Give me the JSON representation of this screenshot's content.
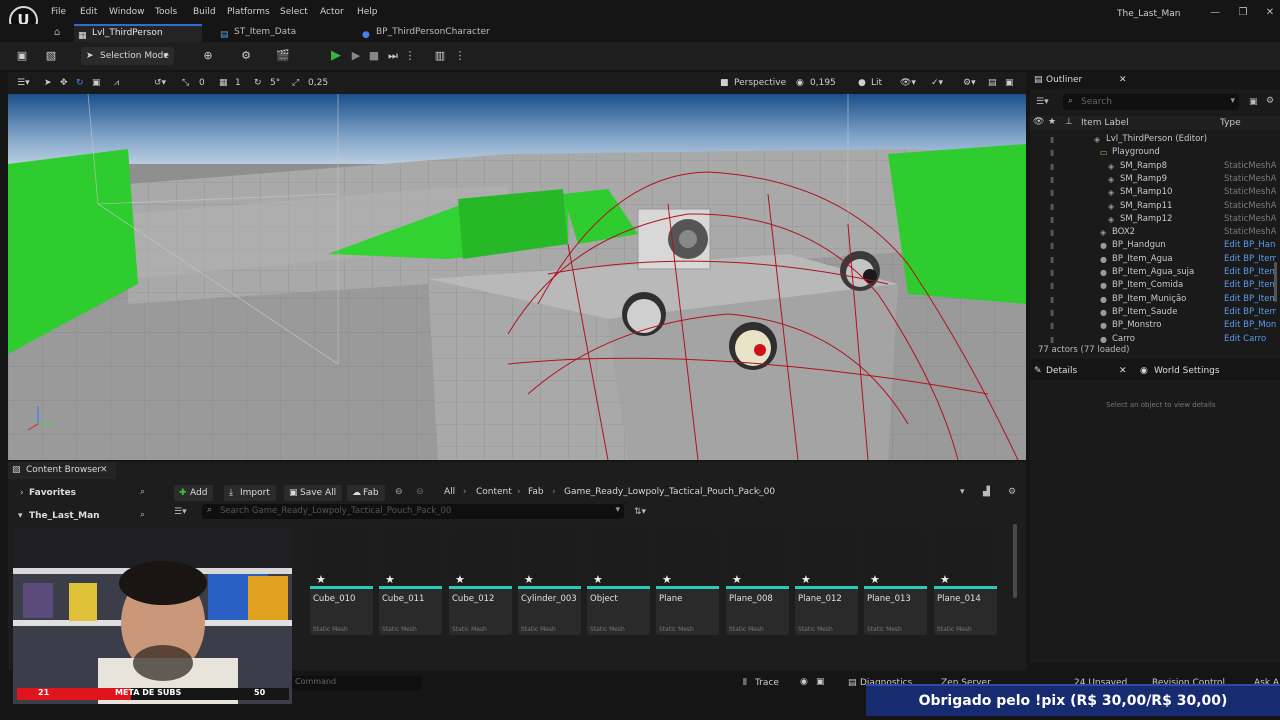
{
  "app": {
    "logo_glyph": "U",
    "window_title": "The_Last_Man",
    "menu": [
      "File",
      "Edit",
      "Window",
      "Tools",
      "Build",
      "Platforms",
      "Select",
      "Actor",
      "Help"
    ],
    "window_controls": [
      "—",
      "❐",
      "✕"
    ]
  },
  "tabs": [
    {
      "label": "Lvl_ThirdPerson",
      "icon": "level-icon",
      "active": true
    },
    {
      "label": "ST_Item_Data",
      "icon": "table-icon",
      "active": false
    },
    {
      "label": "BP_ThirdPersonCharacter",
      "icon": "blueprint-icon",
      "active": false
    }
  ],
  "toolbar": {
    "selection_mode": "Selection Mode"
  },
  "viewport_toolbar": {
    "rotation_snap_value": "0",
    "grid_value": "1",
    "angle_value": "5°",
    "scale_value": "0,25",
    "perspective_label": "Perspective",
    "camera_speed": "0,195",
    "view_mode": "Lit"
  },
  "outliner": {
    "title": "Outliner",
    "search_placeholder": "Search",
    "col_label": "Item Label",
    "col_type": "Type",
    "rows": [
      {
        "label": "Lvl_ThirdPerson (Editor)",
        "type": "",
        "indent": 0
      },
      {
        "label": "Playground",
        "type": "",
        "indent": 1
      },
      {
        "label": "SM_Ramp8",
        "type": "StaticMeshAc",
        "indent": 2
      },
      {
        "label": "SM_Ramp9",
        "type": "StaticMeshAc",
        "indent": 2
      },
      {
        "label": "SM_Ramp10",
        "type": "StaticMeshAc",
        "indent": 2
      },
      {
        "label": "SM_Ramp11",
        "type": "StaticMeshAc",
        "indent": 2
      },
      {
        "label": "SM_Ramp12",
        "type": "StaticMeshAc",
        "indent": 2
      },
      {
        "label": "BOX2",
        "type": "StaticMeshAc",
        "indent": 1
      },
      {
        "label": "BP_Handgun",
        "type": "Edit BP_Hand",
        "indent": 1,
        "link": true
      },
      {
        "label": "BP_Item_Agua",
        "type": "Edit BP_Item_",
        "indent": 1,
        "link": true
      },
      {
        "label": "BP_Item_Agua_suja",
        "type": "Edit BP_Item_",
        "indent": 1,
        "link": true
      },
      {
        "label": "BP_Item_Comida",
        "type": "Edit BP_Item_",
        "indent": 1,
        "link": true
      },
      {
        "label": "BP_Item_Munição",
        "type": "Edit BP_Item_",
        "indent": 1,
        "link": true
      },
      {
        "label": "BP_Item_Saude",
        "type": "Edit BP_Item_",
        "indent": 1,
        "link": true
      },
      {
        "label": "BP_Monstro",
        "type": "Edit BP_Mons",
        "indent": 1,
        "link": true
      },
      {
        "label": "Carro",
        "type": "Edit Carro",
        "indent": 1,
        "link": true
      }
    ],
    "actor_count": "77 actors (77 loaded)"
  },
  "details": {
    "title": "Details",
    "world_settings": "World Settings",
    "empty_message": "Select an object to view details"
  },
  "content_browser": {
    "title": "Content Browser",
    "favorites": "Favorites",
    "project": "The_Last_Man",
    "add": "Add",
    "import": "Import",
    "save_all": "Save All",
    "fab": "Fab",
    "breadcrumb": [
      "All",
      "Content",
      "Fab",
      "Game_Ready_Lowpoly_Tactical_Pouch_Pack_00"
    ],
    "search_placeholder": "Search Game_Ready_Lowpoly_Tactical_Pouch_Pack_00",
    "assets": [
      {
        "name": "Cube_010",
        "kind": "Static Mesh"
      },
      {
        "name": "Cube_011",
        "kind": "Static Mesh"
      },
      {
        "name": "Cube_012",
        "kind": "Static Mesh"
      },
      {
        "name": "Cylinder_003",
        "kind": "Static Mesh"
      },
      {
        "name": "Object",
        "kind": "Static Mesh"
      },
      {
        "name": "Plane",
        "kind": "Static Mesh"
      },
      {
        "name": "Plane_008",
        "kind": "Static Mesh"
      },
      {
        "name": "Plane_012",
        "kind": "Static Mesh"
      },
      {
        "name": "Plane_013",
        "kind": "Static Mesh"
      },
      {
        "name": "Plane_014",
        "kind": "Static Mesh"
      }
    ]
  },
  "statusbar": {
    "command_placeholder": "Command",
    "trace": "Trace",
    "diagnostics": "Diagnostics",
    "zen_server": "Zen Server",
    "unsaved": "24 Unsaved",
    "revision_control": "Revision Control",
    "ask": "Ask AI"
  },
  "overlay": {
    "subs_left": "21",
    "subs_label": "META DE SUBS",
    "subs_right": "50",
    "subs_progress": 0.42,
    "pix_message": "Obrigado pelo !pix (R$ 30,00/R$ 30,00)"
  },
  "colors": {
    "accent_blue": "#2d6fd1",
    "play_green": "#37b43c",
    "asset_bar": "#2cc9b4",
    "link_blue": "#5a9cf0",
    "pix_banner": "#162b70",
    "subs_fill": "#e0141c"
  }
}
